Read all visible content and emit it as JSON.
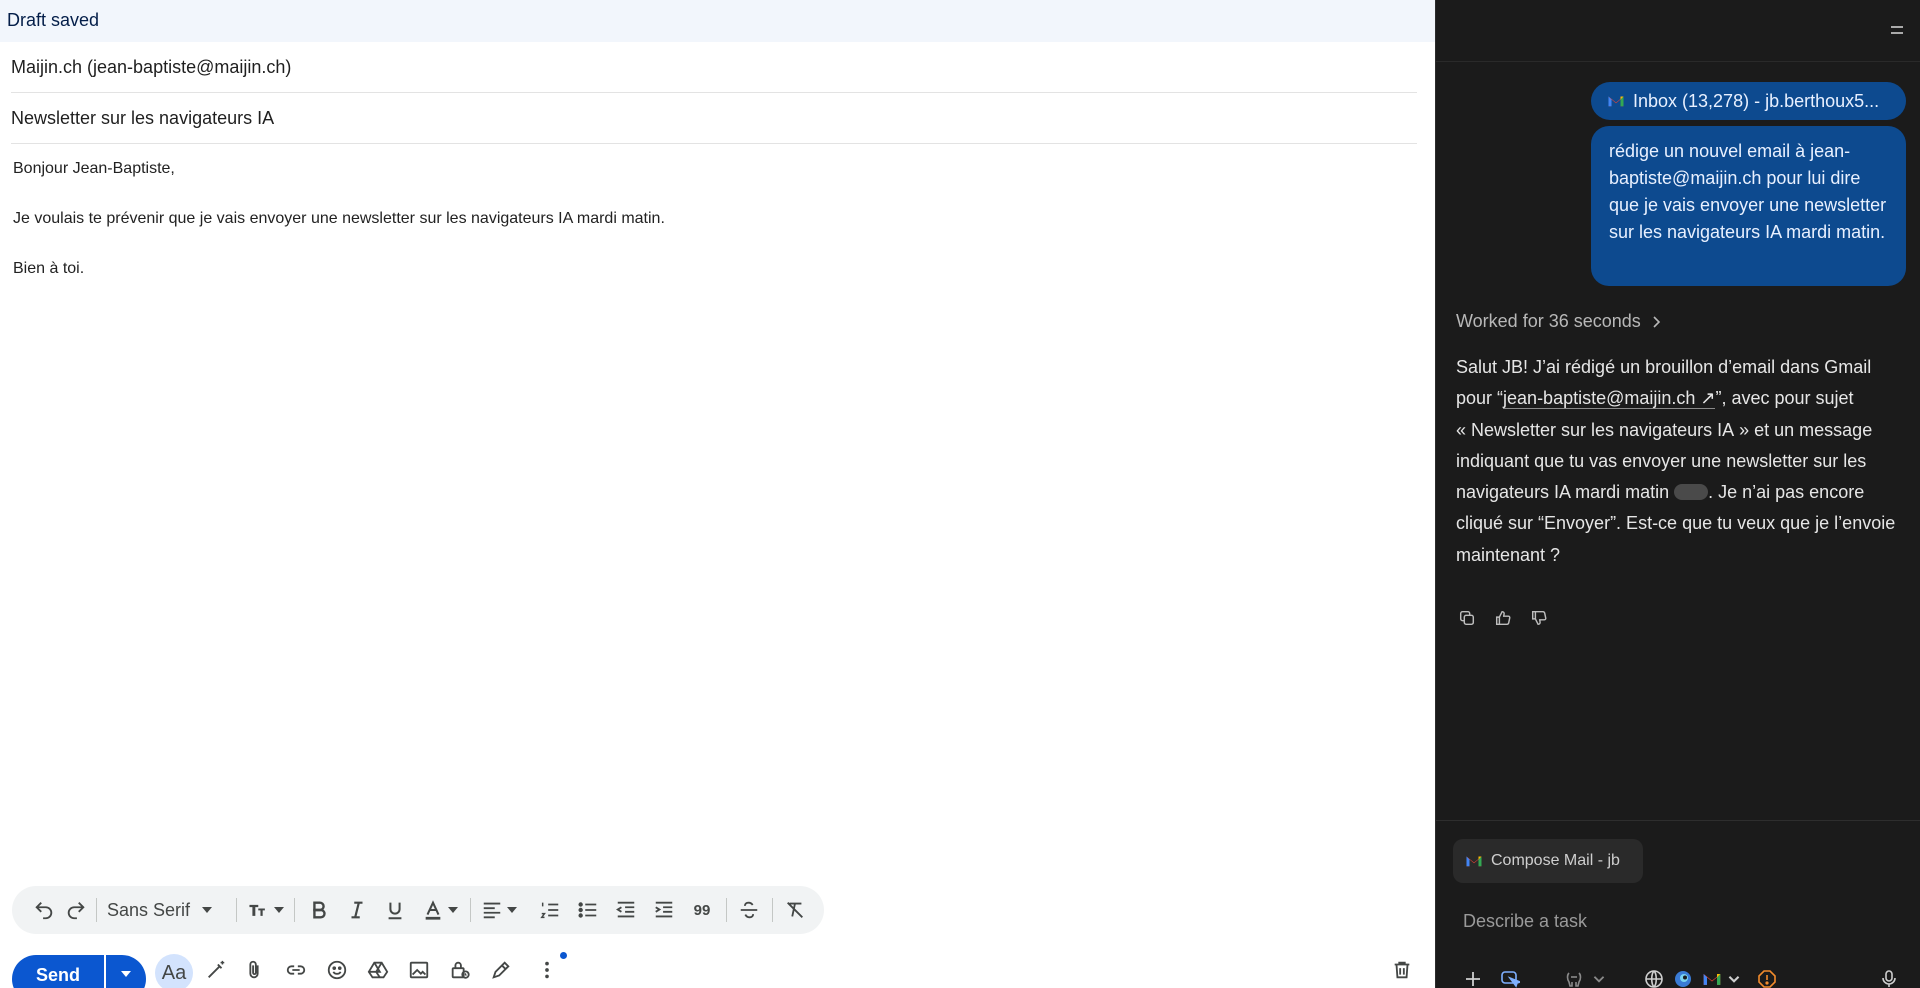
{
  "compose": {
    "status": "Draft saved",
    "from": "Maijin.ch (jean-baptiste@maijin.ch)",
    "subject": "Newsletter sur les navigateurs IA",
    "body": {
      "greeting": "Bonjour Jean-Baptiste,",
      "line1": "Je voulais te prévenir que je vais envoyer une newsletter sur les navigateurs IA mardi matin.",
      "closing": "Bien à toi."
    },
    "toolbar": {
      "font": "Sans Serif",
      "quote_glyph": "99"
    },
    "send_label": "Send",
    "aa_label": "Aa"
  },
  "assistant": {
    "context_chip": "Inbox (13,278) - jb.berthoux5...",
    "user_message": "rédige un nouvel email à jean-baptiste@maijin.ch pour lui dire que je vais envoyer une newsletter sur les navigateurs IA mardi matin.",
    "worked_label": "Worked for 36 seconds",
    "answer": {
      "part1": "Salut JB! J’ai rédigé un brouillon d’email dans Gmail pour “",
      "link": "jean-baptiste@maijin.ch ↗",
      "part2": "”, avec pour sujet « Newsletter sur les navigateurs IA » et un message indiquant que tu vas envoyer une newsletter sur les navigateurs IA mardi matin ",
      "part3": ". Je n’ai pas encore cliqué sur “Envoyer”. Est-ce que tu veux que je l’envoie maintenant ?"
    },
    "tab_chip": "Compose Mail - jb",
    "input_placeholder": "Describe a task"
  },
  "colors": {
    "accent": "#0b57d0",
    "bubble": "#0d4a8f",
    "panel_bg": "#1b1b1b",
    "compose_header": "#f2f6fc",
    "warning": "#f28b2c"
  }
}
